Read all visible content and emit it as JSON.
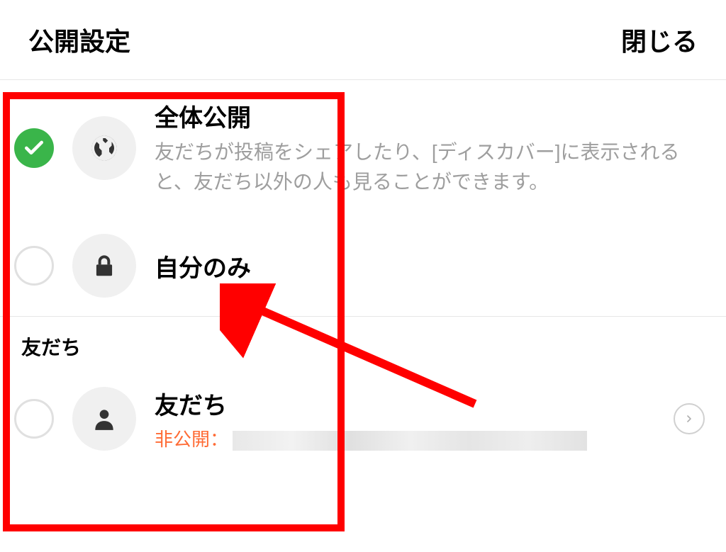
{
  "header": {
    "title": "公開設定",
    "close_label": "閉じる"
  },
  "options": [
    {
      "title": "全体公開",
      "desc": "友だちが投稿をシェアしたり、[ディスカバー]に表示されると、友だち以外の人も見ることができます。",
      "selected": true
    },
    {
      "title": "自分のみ",
      "desc": "",
      "selected": false
    }
  ],
  "section_label": "友だち",
  "friends_option": {
    "title": "友だち",
    "private_prefix": "非公開："
  }
}
